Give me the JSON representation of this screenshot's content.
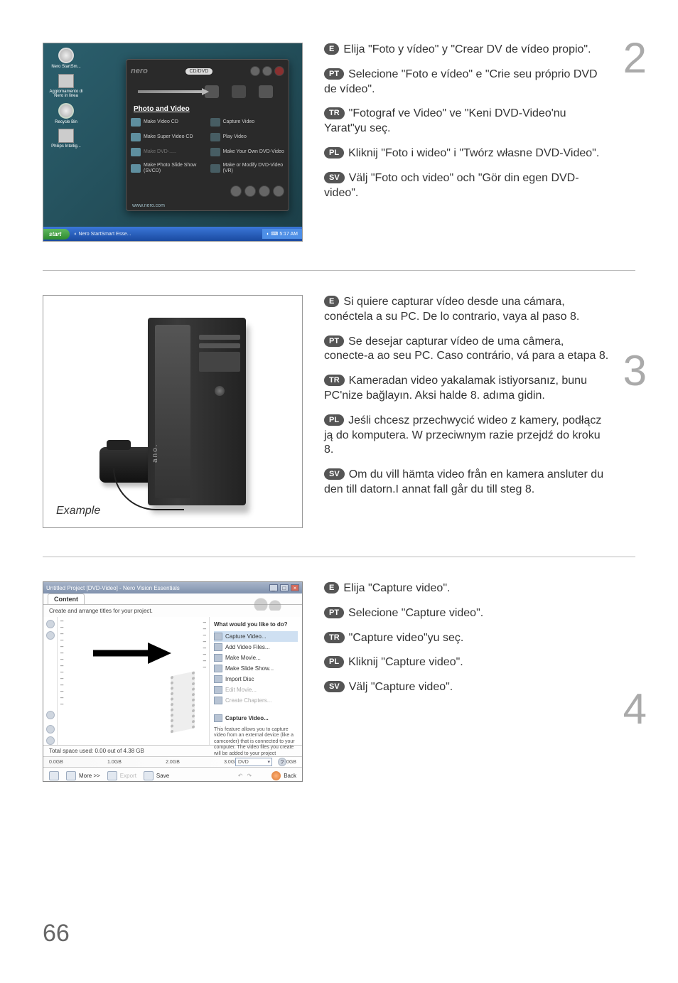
{
  "page_number": "66",
  "step2": {
    "number": "2",
    "languages": [
      {
        "code": "E",
        "text": "Elija \"Foto y vídeo\" y \"Crear DV de vídeo propio\"."
      },
      {
        "code": "PT",
        "text": "Selecione \"Foto e vídeo\" e \"Crie seu próprio DVD de vídeo\"."
      },
      {
        "code": "TR",
        "text": "\"Fotograf ve Video\" ve \"Keni DVD-Video'nu Yarat\"yu seç."
      },
      {
        "code": "PL",
        "text": "Kliknij \"Foto i wideo\" i \"Twórz własne DVD-Video\"."
      },
      {
        "code": "SV",
        "text": "Välj \"Foto och video\" och \"Gör din egen DVD-video\"."
      }
    ],
    "screenshot": {
      "desktop_icons": [
        {
          "label": "Nero StartSm..."
        },
        {
          "label": "Aggiornamento di Nero in linea"
        },
        {
          "label": "Recycle Bin"
        },
        {
          "label": "Philips Intellig..."
        }
      ],
      "nero_logo": "nero",
      "top_pill": "CD/DVD",
      "section_title": "Photo and Video",
      "menu_left": [
        "Make Video CD",
        "Make Super Video CD",
        "Make DVD-.....",
        "Make Photo Slide Show (SVCD)"
      ],
      "menu_right": [
        "Capture Video",
        "Play Video",
        "Make Your Own DVD-Video",
        "Make or Modify DVD-Video (VR)"
      ],
      "url": "www.nero.com",
      "start": "start",
      "task_app": "Nero StartSmart Esse...",
      "tray_time": "5:17 AM"
    }
  },
  "step3": {
    "number": "3",
    "image_caption": "Example",
    "pc_label": "ano.",
    "languages": [
      {
        "code": "E",
        "text": "Si quiere capturar vídeo desde una cámara, conéctela a su PC. De lo contrario, vaya al paso 8."
      },
      {
        "code": "PT",
        "text": "Se desejar capturar vídeo de uma câmera, conecte-a ao seu PC. Caso contrário, vá para a etapa 8."
      },
      {
        "code": "TR",
        "text": "Kameradan video yakalamak istiyorsanız, bunu PC'nize bağlayın. Aksi halde 8. adıma gidin."
      },
      {
        "code": "PL",
        "text": "Jeśli chcesz przechwycić wideo z kamery, podłącz ją do komputera. W przeciwnym razie przejdź do kroku 8."
      },
      {
        "code": "SV",
        "text": "Om du vill hämta video från en kamera ansluter du den till datorn.I annat fall går du till steg 8."
      }
    ]
  },
  "step4": {
    "number": "4",
    "languages": [
      {
        "code": "E",
        "text": "Elija \"Capture video\"."
      },
      {
        "code": "PT",
        "text": "Selecione \"Capture video\"."
      },
      {
        "code": "TR",
        "text": "\"Capture video\"yu seç."
      },
      {
        "code": "PL",
        "text": "Kliknij \"Capture video\"."
      },
      {
        "code": "SV",
        "text": "Välj \"Capture video\"."
      }
    ],
    "screenshot": {
      "title": "Untitled Project [DVD-Video] - Nero Vision Essentials",
      "tab": "Content",
      "subhead": "Create and arrange titles for your project.",
      "question": "What would you like to do?",
      "options": [
        {
          "label": "Capture Video...",
          "highlight": true
        },
        {
          "label": "Add Video Files...",
          "highlight": false
        },
        {
          "label": "Make Movie...",
          "highlight": false
        },
        {
          "label": "Make Slide Show...",
          "highlight": false
        },
        {
          "label": "Import Disc",
          "highlight": false
        },
        {
          "label": "Edit Movie...",
          "highlight": false,
          "dim": true
        },
        {
          "label": "Create Chapters...",
          "highlight": false,
          "dim": true
        }
      ],
      "option_repeat": "Capture Video...",
      "description": "This feature allows you to capture video from an external device (like a camcorder) that is connected to your computer. The video files you create will be added to your project automatically.",
      "status": "Total space used: 0.00 out of 4.38 GB",
      "scale": [
        "0.0GB",
        "1.0GB",
        "2.0GB",
        "3.0GB",
        "4.0GB"
      ],
      "media_select": "DVD",
      "toolbar": {
        "more": "More >>",
        "export": "Export",
        "save": "Save",
        "back": "Back"
      }
    }
  }
}
